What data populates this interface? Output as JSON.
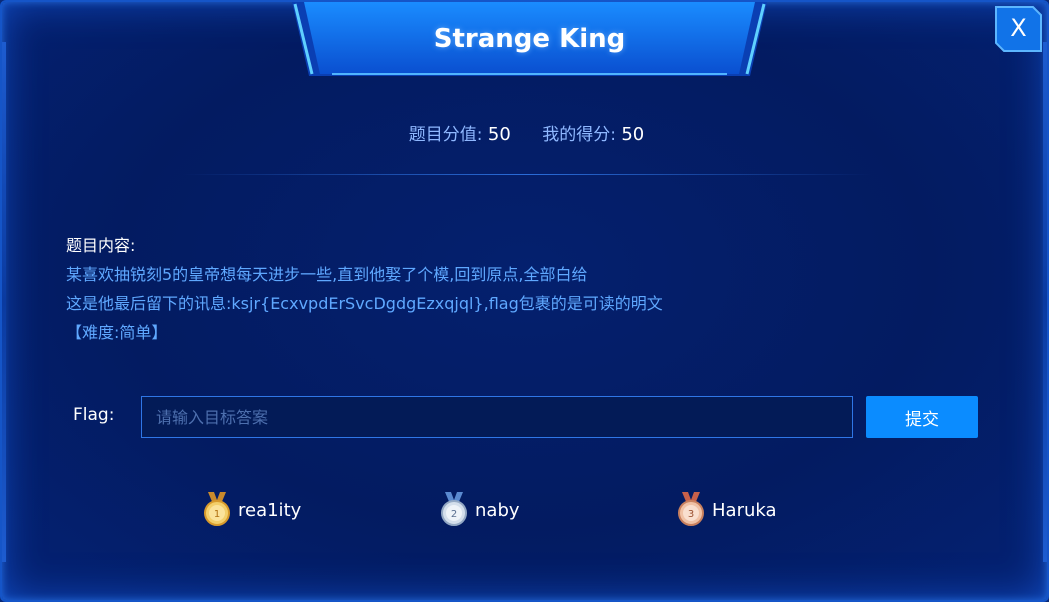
{
  "modal": {
    "title": "Strange King",
    "close_label": "X"
  },
  "score": {
    "value_label": "题目分值:",
    "value": "50",
    "mine_label": "我的得分:",
    "mine": "50"
  },
  "content": {
    "heading": "题目内容:",
    "lines": [
      "某喜欢抽锐刻5的皇帝想每天进步一些,直到他娶了个模,回到原点,全部白给",
      "这是他最后留下的讯息:ksjr{EcxvpdErSvcDgdgEzxqjql},flag包裹的是可读的明文",
      "【难度:简单】"
    ]
  },
  "flag": {
    "label": "Flag:",
    "placeholder": "请输入目标答案",
    "value": "",
    "submit_label": "提交"
  },
  "ranking": [
    {
      "rank": "1",
      "name": "rea1ity",
      "medal": "gold-medal-icon",
      "color": "#e8b84a"
    },
    {
      "rank": "2",
      "name": "naby",
      "medal": "silver-medal-icon",
      "color": "#b8c8dc"
    },
    {
      "rank": "3",
      "name": "Haruka",
      "medal": "bronze-medal-icon",
      "color": "#d99a7a"
    }
  ],
  "colors": {
    "background": "#031b61",
    "accent": "#0b8cff",
    "text_highlight": "#5fa8ff"
  }
}
